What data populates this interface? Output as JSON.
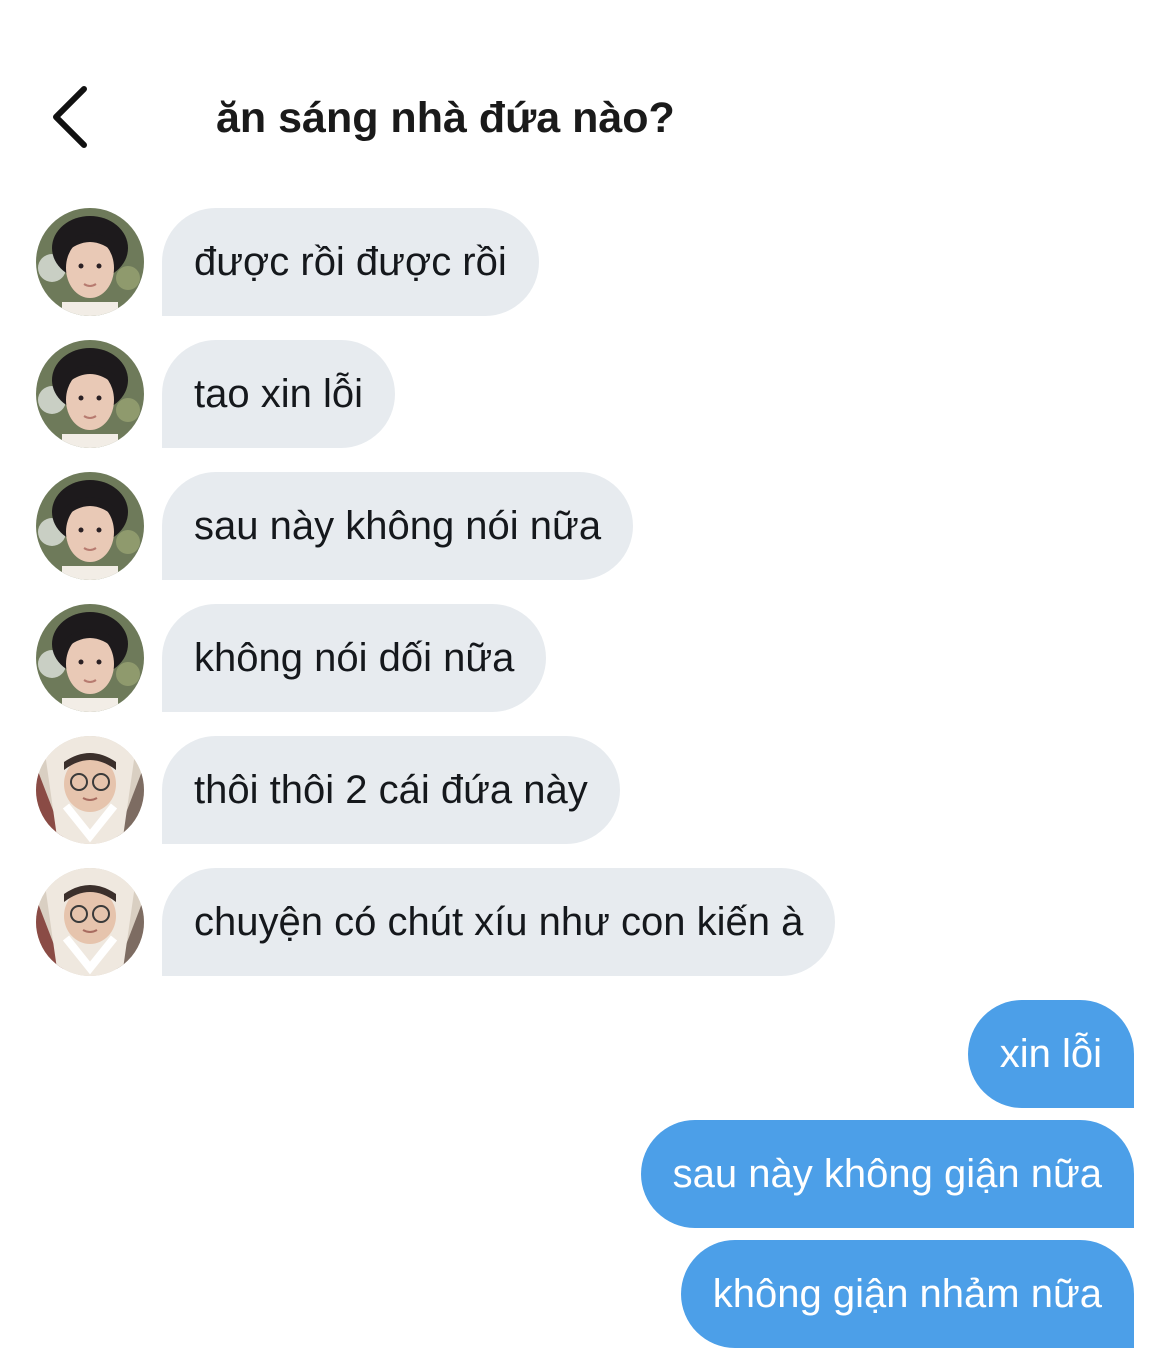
{
  "header": {
    "title": "ăn sáng nhà đứa nào?",
    "back_icon": "chevron-left-icon"
  },
  "messages_in": [
    {
      "text": "được rồi được rồi",
      "avatar": "avatar-person-1"
    },
    {
      "text": "tao xin lỗi",
      "avatar": "avatar-person-1"
    },
    {
      "text": "sau này không nói nữa",
      "avatar": "avatar-person-1"
    },
    {
      "text": "không nói dối nữa",
      "avatar": "avatar-person-1"
    },
    {
      "text": "thôi thôi 2 cái đứa này",
      "avatar": "avatar-person-2"
    },
    {
      "text": "chuyện có chút xíu như con kiến à",
      "avatar": "avatar-person-2"
    }
  ],
  "messages_out": [
    {
      "text": "xin lỗi"
    },
    {
      "text": "sau này không giận nữa"
    },
    {
      "text": "không giận nhảm nữa"
    }
  ],
  "colors": {
    "incoming_bubble": "#e7ebef",
    "outgoing_bubble": "#4c9fe8",
    "text": "#15181c"
  }
}
